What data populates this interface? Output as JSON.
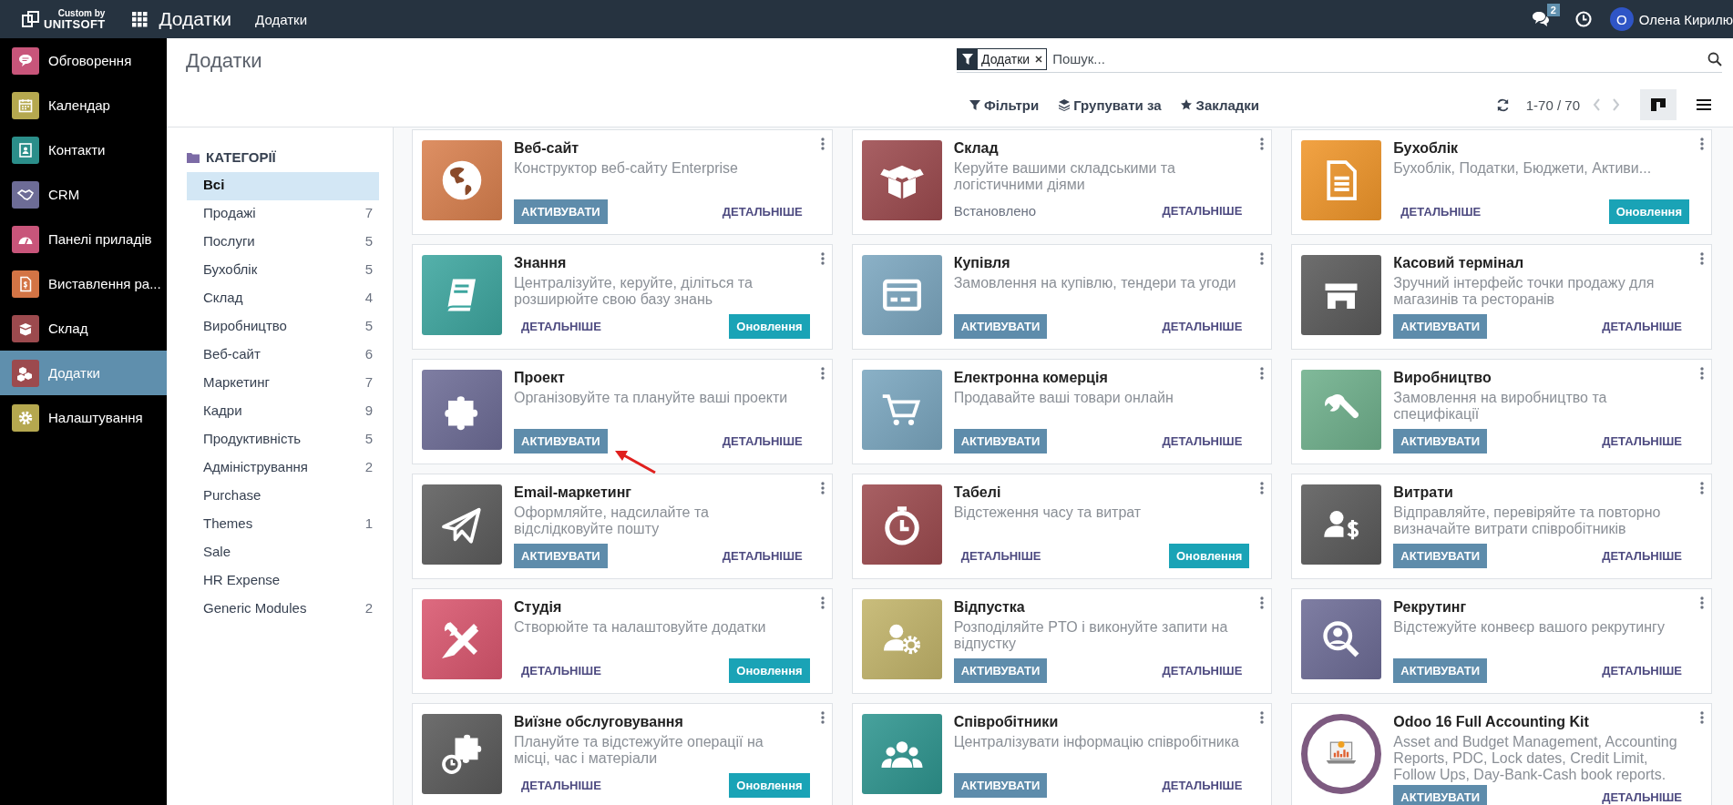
{
  "top_bar": {
    "logo": {
      "line_1": "Custom by",
      "line_2": "UNITSOFT"
    },
    "app_title": "Додатки",
    "menu": [
      "Додатки"
    ],
    "messages_badge": "2",
    "user": {
      "avatar_letter": "O",
      "name": "Олена Кирилю"
    }
  },
  "sidebar": {
    "items": [
      {
        "label": "Обговорення",
        "color": "#c8557a",
        "selected": false
      },
      {
        "label": "Календар",
        "color": "#b5a84f",
        "selected": false
      },
      {
        "label": "Контакти",
        "color": "#2b8e8a",
        "selected": false
      },
      {
        "label": "CRM",
        "color": "#6d6c96",
        "selected": false
      },
      {
        "label": "Панелі приладів",
        "color": "#c8557a",
        "selected": false
      },
      {
        "label": "Виставлення ра...",
        "color": "#d37445",
        "selected": false
      },
      {
        "label": "Склад",
        "color": "#9c4a4e",
        "selected": false
      },
      {
        "label": "Додатки",
        "color": "#9c4a4e",
        "selected": true
      },
      {
        "label": "Налаштування",
        "color": "#b5a84f",
        "selected": false
      }
    ]
  },
  "control_panel": {
    "title": "Додатки",
    "search": {
      "facet": "Додатки",
      "placeholder": "Пошук..."
    },
    "buttons": [
      "Фільтри",
      "Групувати за",
      "Закладки"
    ],
    "pager": "1-70 / 70",
    "views": [
      {
        "kind": "kanban",
        "selected": true
      },
      {
        "kind": "list",
        "selected": false
      }
    ]
  },
  "categories": {
    "heading": "КАТЕГОРІЇ",
    "items": [
      {
        "label": "Всі",
        "selected": true
      },
      {
        "label": "Продажі",
        "count": "7",
        "selected": false
      },
      {
        "label": "Послуги",
        "count": "5",
        "selected": false
      },
      {
        "label": "Бухоблік",
        "count": "5",
        "selected": false
      },
      {
        "label": "Склад",
        "count": "4",
        "selected": false
      },
      {
        "label": "Виробництво",
        "count": "5",
        "selected": false
      },
      {
        "label": "Веб-сайт",
        "count": "6",
        "selected": false
      },
      {
        "label": "Маркетинг",
        "count": "7",
        "selected": false
      },
      {
        "label": "Кадри",
        "count": "9",
        "selected": false
      },
      {
        "label": "Продуктивність",
        "count": "5",
        "selected": false
      },
      {
        "label": "Адміністрування",
        "count": "2",
        "selected": false
      },
      {
        "label": "Purchase",
        "selected": false
      },
      {
        "label": "Themes",
        "count": "1",
        "selected": false
      },
      {
        "label": "Sale",
        "selected": false
      },
      {
        "label": "HR Expense",
        "selected": false
      },
      {
        "label": "Generic Modules",
        "count": "2",
        "selected": false
      }
    ]
  },
  "apps": [
    {
      "title": "Веб-сайт",
      "description": "Конструктор веб-сайту Enterprise",
      "kind": "tile",
      "color": "#d9804e",
      "pointer_arrow": false,
      "actions": [
        {
          "kind": "activate",
          "label": "АКТИВУВАТИ"
        },
        {
          "kind": "details",
          "label": "ДЕТАЛЬНІШЕ"
        }
      ]
    },
    {
      "title": "Склад",
      "description": "Керуйте вашими складськими та логістичними діями",
      "kind": "tile",
      "color": "#9c4a4e",
      "pointer_arrow": false,
      "actions": [
        {
          "kind": "installed",
          "label": "Встановлено"
        },
        {
          "kind": "details",
          "label": "ДЕТАЛЬНІШЕ"
        }
      ]
    },
    {
      "title": "Бухоблік",
      "description": "Бухоблік, Податки, Бюджети, Активи...",
      "kind": "tile",
      "color": "#f0962a",
      "pointer_arrow": false,
      "actions": [
        {
          "kind": "details",
          "label": "ДЕТАЛЬНІШЕ"
        },
        {
          "kind": "upgrade",
          "label": "Оновлення"
        }
      ]
    },
    {
      "title": "Знання",
      "description": "Централізуйте, керуйте, діліться та розширюйте свою базу знань",
      "kind": "tile",
      "color": "#3da69f",
      "pointer_arrow": false,
      "actions": [
        {
          "kind": "details",
          "label": "ДЕТАЛЬНІШЕ"
        },
        {
          "kind": "upgrade",
          "label": "Оновлення"
        }
      ]
    },
    {
      "title": "Купівля",
      "description": "Замовлення на купівлю, тендери та угоди",
      "kind": "tile",
      "color": "#7ba6bf",
      "pointer_arrow": false,
      "actions": [
        {
          "kind": "activate",
          "label": "АКТИВУВАТИ"
        },
        {
          "kind": "details",
          "label": "ДЕТАЛЬНІШЕ"
        }
      ]
    },
    {
      "title": "Касовий термінал",
      "description": "Зручний інтерфейс точки продажу для магазинів та ресторанів",
      "kind": "tile",
      "color": "#5a5a5a",
      "pointer_arrow": false,
      "actions": [
        {
          "kind": "activate",
          "label": "АКТИВУВАТИ"
        },
        {
          "kind": "details",
          "label": "ДЕТАЛЬНІШЕ"
        }
      ]
    },
    {
      "title": "Проект",
      "description": "Організовуйте та плануйте ваші проекти",
      "kind": "tile",
      "color": "#6d6c96",
      "pointer_arrow": true,
      "actions": [
        {
          "kind": "activate",
          "label": "АКТИВУВАТИ"
        },
        {
          "kind": "details",
          "label": "ДЕТАЛЬНІШЕ"
        }
      ]
    },
    {
      "title": "Електронна комерція",
      "description": "Продавайте ваші товари онлайн",
      "kind": "tile",
      "color": "#7aa6bf",
      "pointer_arrow": false,
      "actions": [
        {
          "kind": "activate",
          "label": "АКТИВУВАТИ"
        },
        {
          "kind": "details",
          "label": "ДЕТАЛЬНІШЕ"
        }
      ]
    },
    {
      "title": "Виробництво",
      "description": "Замовлення на виробництво та специфікації",
      "kind": "tile",
      "color": "#6fb08c",
      "pointer_arrow": false,
      "actions": [
        {
          "kind": "activate",
          "label": "АКТИВУВАТИ"
        },
        {
          "kind": "details",
          "label": "ДЕТАЛЬНІШЕ"
        }
      ]
    },
    {
      "title": "Email-маркетинг",
      "description": "Оформляйте, надсилайте та відслідковуйте пошту",
      "kind": "tile",
      "color": "#5c5c5c",
      "pointer_arrow": false,
      "actions": [
        {
          "kind": "activate",
          "label": "АКТИВУВАТИ"
        },
        {
          "kind": "details",
          "label": "ДЕТАЛЬНІШЕ"
        }
      ]
    },
    {
      "title": "Табелі",
      "description": "Відстеження часу та витрат",
      "kind": "tile",
      "color": "#9c4a4e",
      "pointer_arrow": false,
      "actions": [
        {
          "kind": "details",
          "label": "ДЕТАЛЬНІШЕ"
        },
        {
          "kind": "upgrade",
          "label": "Оновлення"
        }
      ]
    },
    {
      "title": "Витрати",
      "description": "Відправляйте, перевіряйте та повторно визначайте витрати співробітників",
      "kind": "tile",
      "color": "#5a5a5a",
      "pointer_arrow": false,
      "actions": [
        {
          "kind": "activate",
          "label": "АКТИВУВАТИ"
        },
        {
          "kind": "details",
          "label": "ДЕТАЛЬНІШЕ"
        }
      ]
    },
    {
      "title": "Студія",
      "description": "Створюйте та налаштовуйте додатки",
      "kind": "tile",
      "color": "#d9566e",
      "pointer_arrow": false,
      "actions": [
        {
          "kind": "details",
          "label": "ДЕТАЛЬНІШЕ"
        },
        {
          "kind": "upgrade",
          "label": "Оновлення"
        }
      ]
    },
    {
      "title": "Відпустка",
      "description": "Розподіляйте PTO і виконуйте запити на відпустку",
      "kind": "tile",
      "color": "#c2b46a",
      "pointer_arrow": false,
      "actions": [
        {
          "kind": "activate",
          "label": "АКТИВУВАТИ"
        },
        {
          "kind": "details",
          "label": "ДЕТАЛЬНІШЕ"
        }
      ]
    },
    {
      "title": "Рекрутинг",
      "description": "Відстежуйте конвеєр вашого рекрутингу",
      "kind": "tile",
      "color": "#6d6c96",
      "pointer_arrow": false,
      "actions": [
        {
          "kind": "activate",
          "label": "АКТИВУВАТИ"
        },
        {
          "kind": "details",
          "label": "ДЕТАЛЬНІШЕ"
        }
      ]
    },
    {
      "title": "Виїзне обслуговування",
      "description": "Плануйте та відстежуйте операції на місці, час і матеріали",
      "kind": "tile",
      "color": "#5a5a5a",
      "pointer_arrow": false,
      "actions": [
        {
          "kind": "details",
          "label": "ДЕТАЛЬНІШЕ"
        },
        {
          "kind": "upgrade",
          "label": "Оновлення"
        }
      ]
    },
    {
      "title": "Співробітники",
      "description": "Централізувати інформацію співробітника",
      "kind": "tile",
      "color": "#2e958f",
      "pointer_arrow": false,
      "actions": [
        {
          "kind": "activate",
          "label": "АКТИВУВАТИ"
        },
        {
          "kind": "details",
          "label": "ДЕТАЛЬНІШЕ"
        }
      ]
    },
    {
      "title": "Odoo 16 Full Accounting Kit",
      "description": "Asset and Budget Management, Accounting Reports, PDC, Lock dates, Credit Limit, Follow Ups, Day-Bank-Cash book reports.",
      "kind": "ring",
      "color": "#7d5a80",
      "pointer_arrow": false,
      "actions": [
        {
          "kind": "activate",
          "label": "АКТИВУВАТИ"
        },
        {
          "kind": "details",
          "label": "ДЕТАЛЬНІШЕ"
        }
      ]
    }
  ]
}
